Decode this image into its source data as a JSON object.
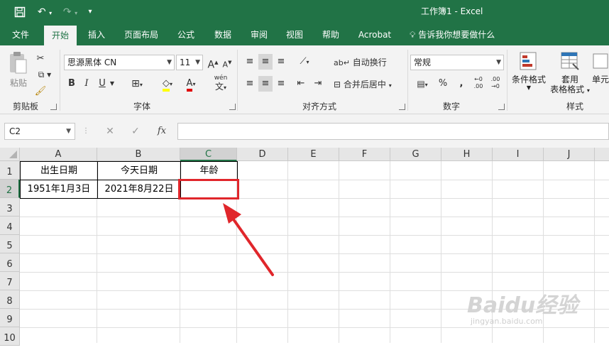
{
  "titlebar": {
    "title": "工作簿1  -  Excel",
    "save_icon": "save-icon",
    "undo_icon": "undo-icon",
    "redo_icon": "redo-icon",
    "customize_icon": "customize-qat-icon"
  },
  "tabs": [
    "文件",
    "开始",
    "插入",
    "页面布局",
    "公式",
    "数据",
    "审阅",
    "视图",
    "帮助",
    "Acrobat"
  ],
  "active_tab": "开始",
  "tellme": "告诉我你想要做什么",
  "ribbon": {
    "clipboard": {
      "paste_label": "粘贴",
      "group_label": "剪贴板"
    },
    "font": {
      "font_name": "思源黑体 CN",
      "font_size": "11",
      "bold": "B",
      "italic": "I",
      "underline": "U",
      "font_a": "A",
      "wen": "wén",
      "group_label": "字体"
    },
    "alignment": {
      "wrap_text": "自动换行",
      "merge_center": "合并后居中",
      "group_label": "对齐方式"
    },
    "number": {
      "format": "常规",
      "percent": "%",
      "group_label": "数字"
    },
    "styles": {
      "conditional_format": "条件格式",
      "format_as_table_1": "套用",
      "format_as_table_2": "表格格式",
      "cell_styles": "单元",
      "group_label": "样式"
    }
  },
  "formula_bar": {
    "name_box": "C2",
    "fx": "fx",
    "formula": ""
  },
  "sheet": {
    "columns": [
      "A",
      "B",
      "C",
      "D",
      "E",
      "F",
      "G",
      "H",
      "I",
      "J"
    ],
    "rows": [
      "1",
      "2",
      "3",
      "4",
      "5",
      "6",
      "7",
      "8",
      "9",
      "10"
    ],
    "selected_column": "C",
    "selected_row": "2",
    "cells": {
      "A1": "出生日期",
      "B1": "今天日期",
      "C1": "年龄",
      "A2": "1951年1月3日",
      "B2": "2021年8月22日",
      "C2": ""
    }
  },
  "watermark": {
    "brand": "Baidu经验",
    "url": "jingyan.baidu.com"
  },
  "colors": {
    "excel_green": "#217346",
    "highlight_red": "#e0262b"
  }
}
